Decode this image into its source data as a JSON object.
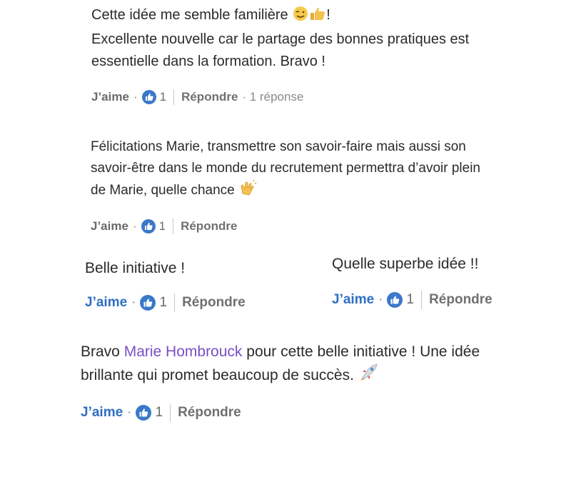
{
  "comments": [
    {
      "lines": [
        "Cette idée me semble familière",
        "Excellente nouvelle car le partage des bonnes pratiques est",
        "essentielle dans la formation. Bravo !"
      ],
      "line1_suffix": "!",
      "emojis": [
        "winking-face-emoji",
        "thumbs-up-emoji"
      ],
      "like_label": "J’aime",
      "like_count": "1",
      "reply_label": "Répondre",
      "replies_label": "· 1 réponse"
    },
    {
      "lines": [
        "Félicitations Marie, transmettre son savoir-faire mais aussi son",
        "savoir-être dans le monde du recrutement permettra d’avoir plein",
        "de Marie, quelle chance"
      ],
      "emojis": [
        "clapping-hands-emoji"
      ],
      "like_label": "J’aime",
      "like_count": "1",
      "reply_label": "Répondre"
    },
    {
      "text": "Belle initiative !",
      "like_label": "J’aime",
      "like_count": "1",
      "reply_label": "Répondre"
    },
    {
      "text": "Quelle superbe idée !!",
      "like_label": "J’aime",
      "like_count": "1",
      "reply_label": "Répondre"
    },
    {
      "prefix": "Bravo",
      "mention": "Marie Hombrouck",
      "suffix": "pour cette belle initiative ! Une idée",
      "line2": "brillante qui promet beaucoup de succès.",
      "emojis": [
        "rocket-emoji"
      ],
      "like_label": "J’aime",
      "like_count": "1",
      "reply_label": "Répondre"
    }
  ],
  "colors": {
    "like_blue": "#2f6fc2",
    "thumb_blue": "#3a78c9",
    "mention_purple": "#7a4fc4"
  }
}
